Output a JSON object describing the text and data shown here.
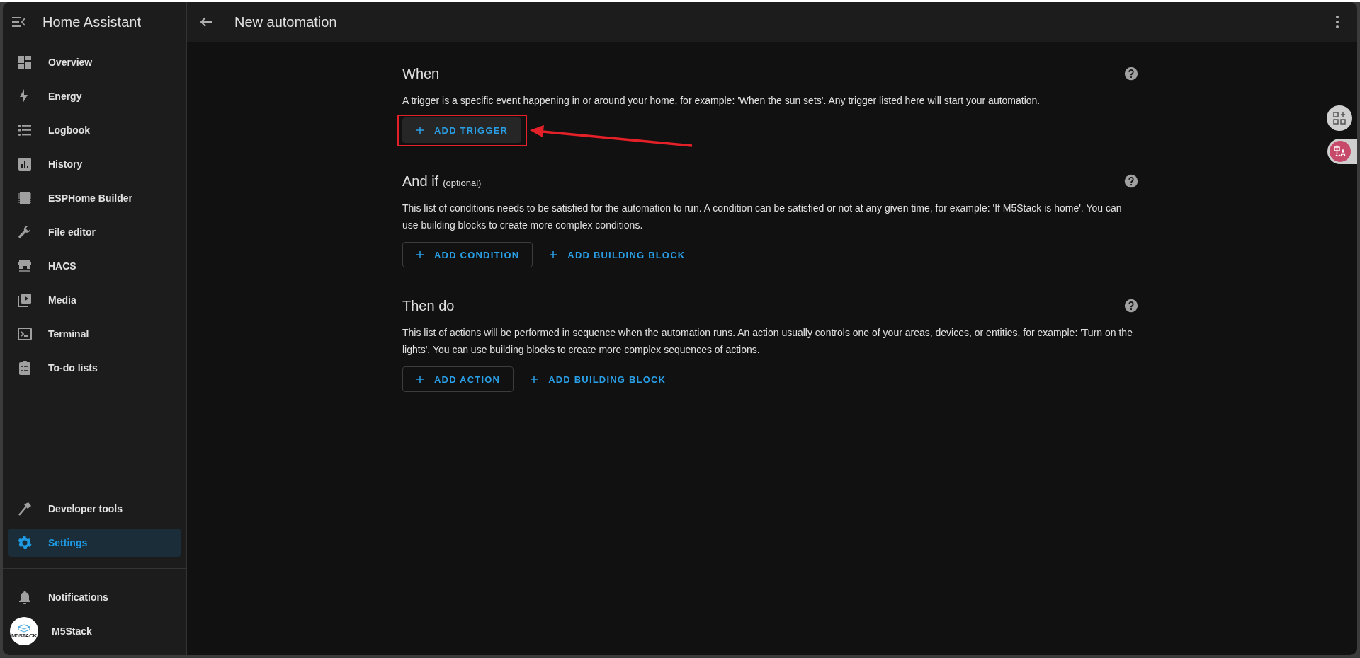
{
  "sidebar": {
    "title": "Home Assistant",
    "items": [
      {
        "label": "Overview",
        "selected": false
      },
      {
        "label": "Energy",
        "selected": false
      },
      {
        "label": "Logbook",
        "selected": false
      },
      {
        "label": "History",
        "selected": false
      },
      {
        "label": "ESPHome Builder",
        "selected": false
      },
      {
        "label": "File editor",
        "selected": false
      },
      {
        "label": "HACS",
        "selected": false
      },
      {
        "label": "Media",
        "selected": false
      },
      {
        "label": "Terminal",
        "selected": false
      },
      {
        "label": "To-do lists",
        "selected": false
      }
    ],
    "bottom_items": [
      {
        "label": "Developer tools",
        "selected": false
      },
      {
        "label": "Settings",
        "selected": true
      }
    ],
    "notifications": "Notifications",
    "user": {
      "name": "M5Stack",
      "avatar_text": "M5STACK"
    }
  },
  "header": {
    "title": "New automation"
  },
  "sections": [
    {
      "title": "When",
      "description": "A trigger is a specific event happening in or around your home, for example: 'When the sun sets'. Any trigger listed here will start your automation.",
      "buttons": [
        {
          "label": "ADD TRIGGER",
          "kind": "tonal",
          "highlighted": true
        }
      ]
    },
    {
      "title": "And if",
      "note": "(optional)",
      "description": "This list of conditions needs to be satisfied for the automation to run. A condition can be satisfied or not at any given time, for example: 'If M5Stack is home'. You can use building blocks to create more complex conditions.",
      "buttons": [
        {
          "label": "ADD CONDITION",
          "kind": "outlined",
          "highlighted": false
        },
        {
          "label": "ADD BUILDING BLOCK",
          "kind": "text",
          "highlighted": false
        }
      ]
    },
    {
      "title": "Then do",
      "description": "This list of actions will be performed in sequence when the automation runs. An action usually controls one of your areas, devices, or entities, for example: 'Turn on the lights'. You can use building blocks to create more complex sequences of actions.",
      "buttons": [
        {
          "label": "ADD ACTION",
          "kind": "outlined",
          "highlighted": false
        },
        {
          "label": "ADD BUILDING BLOCK",
          "kind": "text",
          "highlighted": false
        }
      ]
    }
  ]
}
